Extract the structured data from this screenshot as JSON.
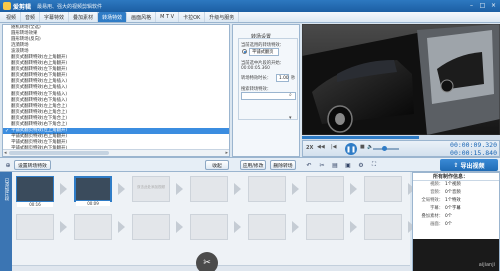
{
  "app": {
    "title": "爱剪辑",
    "subtitle": "最易用、强大的视频剪辑软件",
    "window_controls": [
      "–",
      "□",
      "×"
    ]
  },
  "tabs": [
    {
      "label": "视频"
    },
    {
      "label": "音频"
    },
    {
      "label": "字幕特效"
    },
    {
      "label": "叠加素材"
    },
    {
      "label": "转场特效",
      "active": true
    },
    {
      "label": "画面风格"
    },
    {
      "label": "M T V"
    },
    {
      "label": "卡拉OK"
    },
    {
      "label": "升级与服务"
    }
  ],
  "effects": {
    "items": [
      "随机转场(全选)",
      "圆形转场效果",
      "圆形转场(反向)",
      "涟漪转场",
      "波浪转场",
      "翻页式翻转特效(左上角翻开)",
      "翻页式翻转特效(右上角翻开)",
      "翻页式翻转特效(左下角翻开)",
      "翻页式翻转特效(右下角翻开)",
      "翻页式翻转特效(左上角插入)",
      "翻页式翻转特效(右上角插入)",
      "翻页式翻转特效(左下角插入)",
      "翻页式翻转特效(右下角插入)",
      "翻页式翻转特效(左上角合上)",
      "翻页式翻转特效(右上角合上)",
      "翻页式翻转特效(左下角合上)",
      "翻页式翻转特效(右下角合上)",
      "平铺式翻页特效(左上角翻开)",
      "平铺式翻页特效(右上角翻开)",
      "平铺式翻页特效(左下角翻开)",
      "平铺式翻页特效(右下角翻开)"
    ],
    "selected_index": 17
  },
  "settings": {
    "title": "转场设置",
    "effect_label": "当前选用的转场特效：",
    "effect_value": "平铺式翻页",
    "start_label": "当前选中片段的开始：",
    "start_value": "00:00:05.360",
    "duration_label": "转场特效时长：",
    "duration_value": "1.00",
    "duration_unit": "秒",
    "search_label": "搜索转场特效：",
    "search_value": "",
    "apply_button": "应用/修改",
    "delete_button": "删除转场"
  },
  "toolbar": {
    "add_effect": "设置转场特效",
    "collapse": "收起",
    "export": "导出视频"
  },
  "player": {
    "current_time": "00:00:09.320",
    "total_time": "00:00:15.840",
    "speed_label": "2X",
    "progress_fraction": 0.59,
    "volume_fraction": 0.45
  },
  "timeline": {
    "track_label": "已添加片段",
    "clips": [
      {
        "caption": "00:16",
        "filled": true
      },
      {
        "caption": "00:09",
        "filled": true,
        "selected": true
      }
    ],
    "placeholder": "双击此处添加视频"
  },
  "info": {
    "title": "所有制作信息：",
    "rows": [
      {
        "key": "视频：",
        "value": "1个视频"
      },
      {
        "key": "音频：",
        "value": "0个音频"
      },
      {
        "key": "全局特效：",
        "value": "1个特效"
      },
      {
        "key": "字幕：",
        "value": "0个字幕"
      },
      {
        "key": "叠加素材：",
        "value": "0个"
      },
      {
        "key": "画面：",
        "value": "0个"
      }
    ],
    "watermark": "aijianji"
  },
  "colors": {
    "accent": "#2f7cc6",
    "title_bar": "#1c5fa3"
  }
}
